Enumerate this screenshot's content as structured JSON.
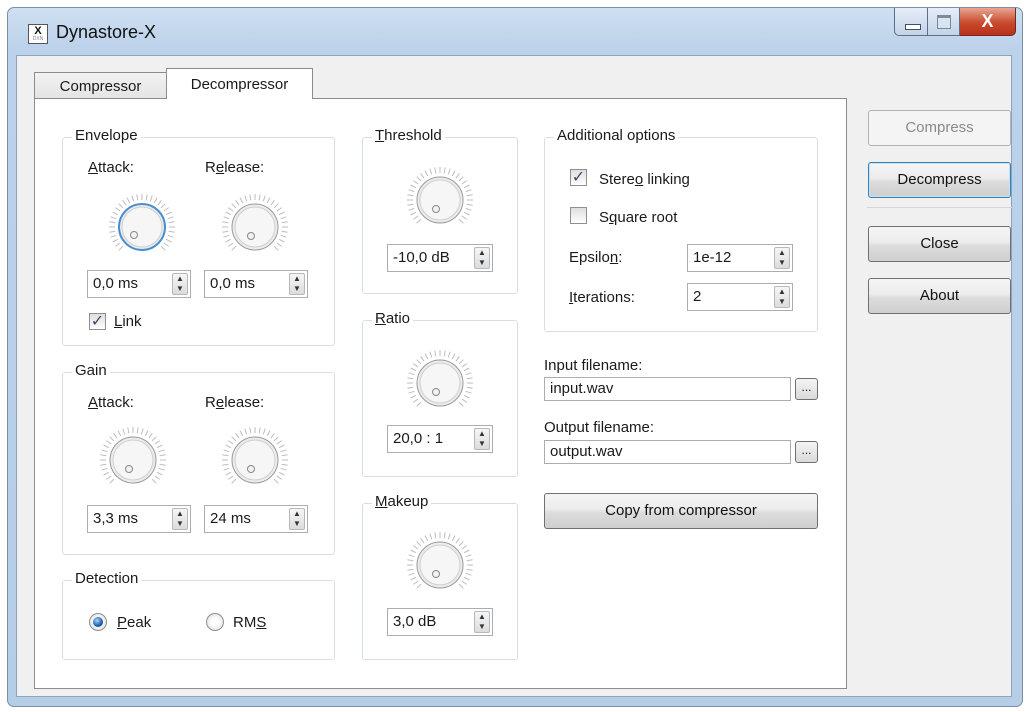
{
  "window": {
    "title": "Dynastore-X",
    "icon_letter": "X",
    "icon_sub": "DXN",
    "close_glyph": "X"
  },
  "tabs": [
    {
      "label": "Compressor",
      "active": false
    },
    {
      "label": "Decompressor",
      "active": true
    }
  ],
  "envelope": {
    "title": "Envelope",
    "attack_label": "Attack:",
    "release_label": "Release:",
    "attack_value": "0,0 ms",
    "release_value": "0,0 ms",
    "link_label": "Link",
    "link_checked": true
  },
  "gain": {
    "title": "Gain",
    "attack_label": "Attack:",
    "release_label": "Release:",
    "attack_value": "3,3 ms",
    "release_value": "24 ms"
  },
  "detection": {
    "title": "Detection",
    "options": [
      "Peak",
      "RMS"
    ],
    "selected": "Peak"
  },
  "threshold": {
    "title": "Threshold",
    "value": "-10,0 dB"
  },
  "ratio": {
    "title": "Ratio",
    "value": "20,0 : 1"
  },
  "makeup": {
    "title": "Makeup",
    "value": "3,0 dB"
  },
  "additional": {
    "title": "Additional options",
    "stereo_linking_label": "Stereo linking",
    "stereo_linking_checked": true,
    "square_root_label": "Square root",
    "square_root_checked": false,
    "epsilon_label": "Epsilon:",
    "epsilon_value": "1e-12",
    "iterations_label": "Iterations:",
    "iterations_value": "2"
  },
  "files": {
    "input_label": "Input filename:",
    "input_value": "input.wav",
    "output_label": "Output filename:",
    "output_value": "output.wav",
    "browse_label": "...",
    "copy_button": "Copy from compressor"
  },
  "buttons": {
    "compress": "Compress",
    "decompress": "Decompress",
    "close": "Close",
    "about": "About"
  },
  "icons": {
    "spin": "spin-up-down-icon",
    "knob": "rotary-knob-icon"
  }
}
